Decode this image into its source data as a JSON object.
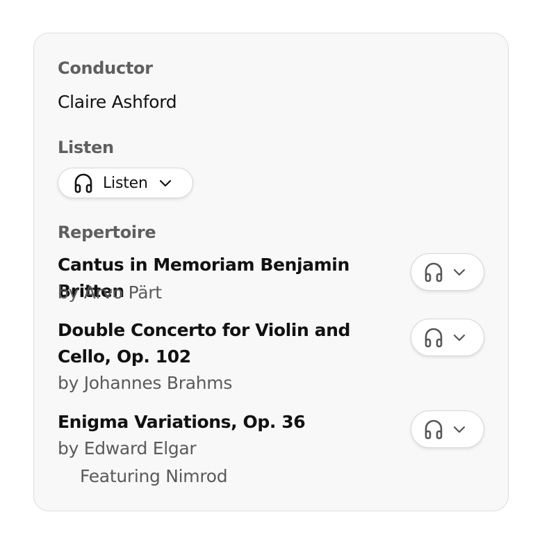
{
  "conductor": {
    "label": "Conductor",
    "name": "Claire Ashford"
  },
  "listen": {
    "label": "Listen",
    "button_label": "Listen",
    "button_icon": "headphones-icon"
  },
  "repertoire": {
    "label": "Repertoire",
    "items": [
      {
        "title": "Cantus in Memoriam Benjamin Britten",
        "composer": "by Arvo Pärt",
        "extra": ""
      },
      {
        "title": "Double Concerto for Violin and Cello, Op. 102",
        "composer": "by Johannes Brahms",
        "extra": ""
      },
      {
        "title": "Enigma Variations, Op. 36",
        "composer": "by Edward Elgar",
        "extra": "Featuring Nimrod"
      }
    ]
  },
  "colors": {
    "card_background": "#f8f8f8",
    "card_border": "#dcdcdc",
    "label_text": "#5f5f5f",
    "secondary_text": "#5a5a5a",
    "primary_text": "#111111"
  }
}
